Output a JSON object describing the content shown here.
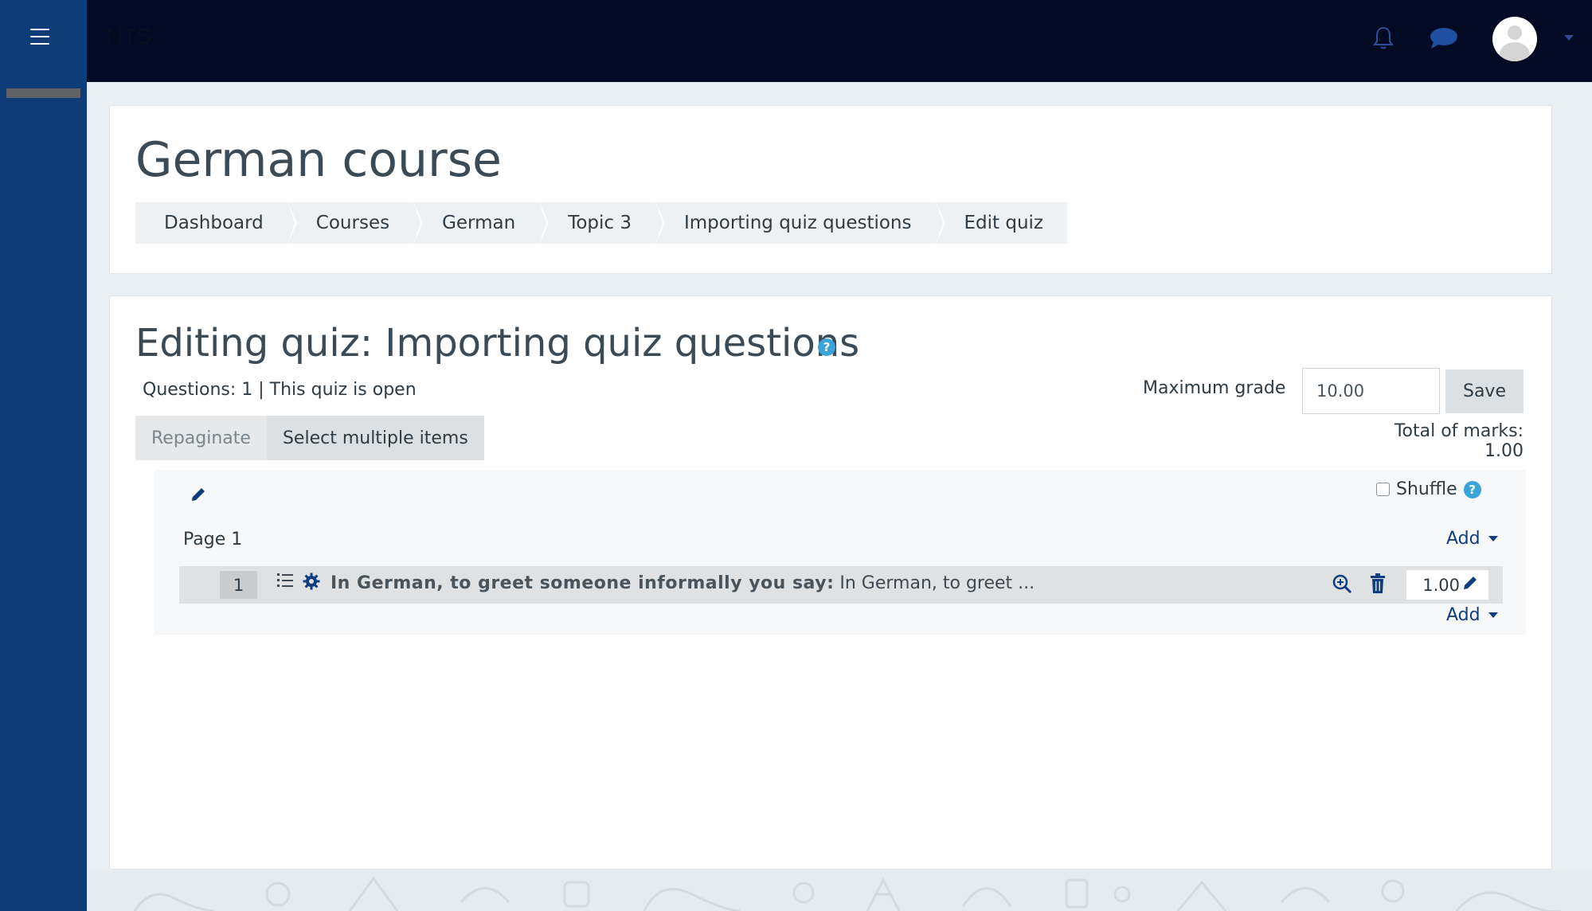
{
  "navbar": {
    "site_name": "NTS",
    "icons": [
      "bell-icon",
      "chat-icon",
      "user-avatar",
      "chevron-down-icon"
    ]
  },
  "header": {
    "course_title": "German course",
    "breadcrumbs": [
      {
        "label": "Dashboard"
      },
      {
        "label": "Courses"
      },
      {
        "label": "German"
      },
      {
        "label": "Topic 3"
      },
      {
        "label": "Importing quiz questions"
      },
      {
        "label": "Edit quiz"
      }
    ]
  },
  "quiz": {
    "title": "Editing quiz: Importing quiz questions",
    "status": "Questions: 1 | This quiz is open",
    "repaginate_label": "Repaginate",
    "select_multiple_label": "Select multiple items",
    "max_grade_label": "Maximum grade",
    "max_grade_value": "10.00",
    "save_label": "Save",
    "total_marks": "Total of marks: 1.00",
    "shuffle_label": "Shuffle",
    "page_label": "Page 1",
    "add_label": "Add",
    "questions": [
      {
        "number": "1",
        "name": "In German, to greet someone informally you say:",
        "preview": "In German, to greet ...",
        "mark": "1.00"
      }
    ]
  },
  "colors": {
    "sidebar": "#0d3c78",
    "navbar": "#030a24",
    "accent": "#0f3d80",
    "help": "#3aa3d9"
  }
}
